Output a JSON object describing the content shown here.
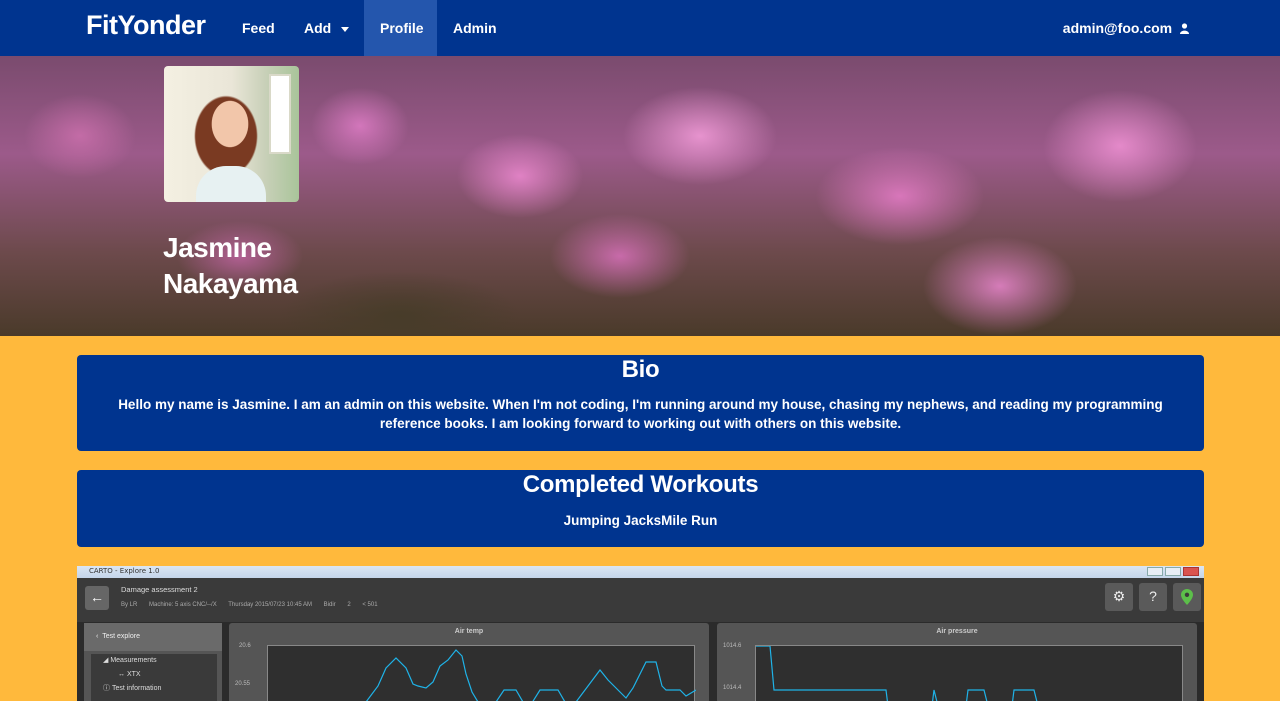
{
  "navbar": {
    "brand": "FitYonder",
    "items": [
      "Feed",
      "Add",
      "Profile",
      "Admin"
    ],
    "active": "Profile",
    "user": "admin@foo.com"
  },
  "profile": {
    "name_line1": "Jasmine",
    "name_line2": "Nakayama"
  },
  "bio": {
    "heading": "Bio",
    "text": "Hello my name is Jasmine. I am an admin on this website. When I'm not coding, I'm running around my house, chasing my nephews, and reading my programming reference books. I am looking forward to working out with others on this website."
  },
  "workouts": {
    "heading": "Completed Workouts",
    "list": "Jumping JacksMile Run"
  },
  "embed": {
    "window_title": "CARTO - Explore 1.0",
    "title": "Damage assessment 2",
    "meta": [
      "By LR",
      "Machine: 5 axis CNC/--/X",
      "Thursday 2015/07/23 10:45 AM",
      "Bidir",
      "2",
      "< 501"
    ],
    "sidebar_head": "Test explore",
    "sidebar_items": [
      "Measurements",
      "XTX",
      "Test information"
    ],
    "panels": [
      {
        "title": "Air temp",
        "ticks": [
          "20.6",
          "20.55"
        ]
      },
      {
        "title": "Air pressure",
        "ticks": [
          "1014.6",
          "1014.4"
        ]
      }
    ]
  },
  "colors": {
    "navbar": "#00348f",
    "page_bg": "#ffb93c",
    "card_bg": "#00348f",
    "plot_line": "#1fb3e8"
  }
}
